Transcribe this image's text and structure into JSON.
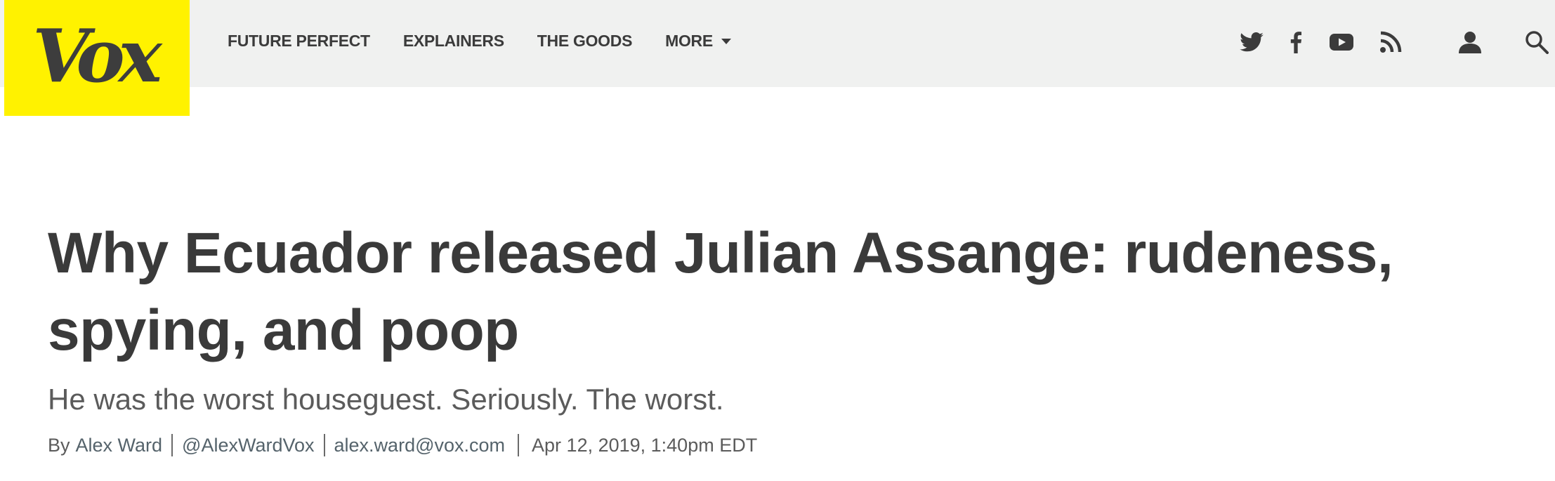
{
  "brand": {
    "logo_text": "Vox",
    "logo_bg": "#fff200"
  },
  "nav": {
    "items": [
      {
        "label": "FUTURE PERFECT"
      },
      {
        "label": "EXPLAINERS"
      },
      {
        "label": "THE GOODS"
      },
      {
        "label": "MORE"
      }
    ]
  },
  "header_icons": [
    "twitter-icon",
    "facebook-icon",
    "youtube-icon",
    "rss-icon",
    "user-icon",
    "search-icon"
  ],
  "article": {
    "headline": "Why Ecuador released Julian Assange: rudeness, spying, and poop",
    "dek": "He was the worst houseguest. Seriously. The worst.",
    "byline": {
      "prefix": "By",
      "author": "Alex Ward",
      "twitter": "@AlexWardVox",
      "email": "alex.ward@vox.com",
      "date": "Apr 12, 2019, 1:40pm EDT"
    }
  },
  "colors": {
    "header_bg": "#f0f1f0",
    "text_dark": "#3a3a3a",
    "text_muted": "#5b5b5b",
    "link": "#55636b"
  }
}
